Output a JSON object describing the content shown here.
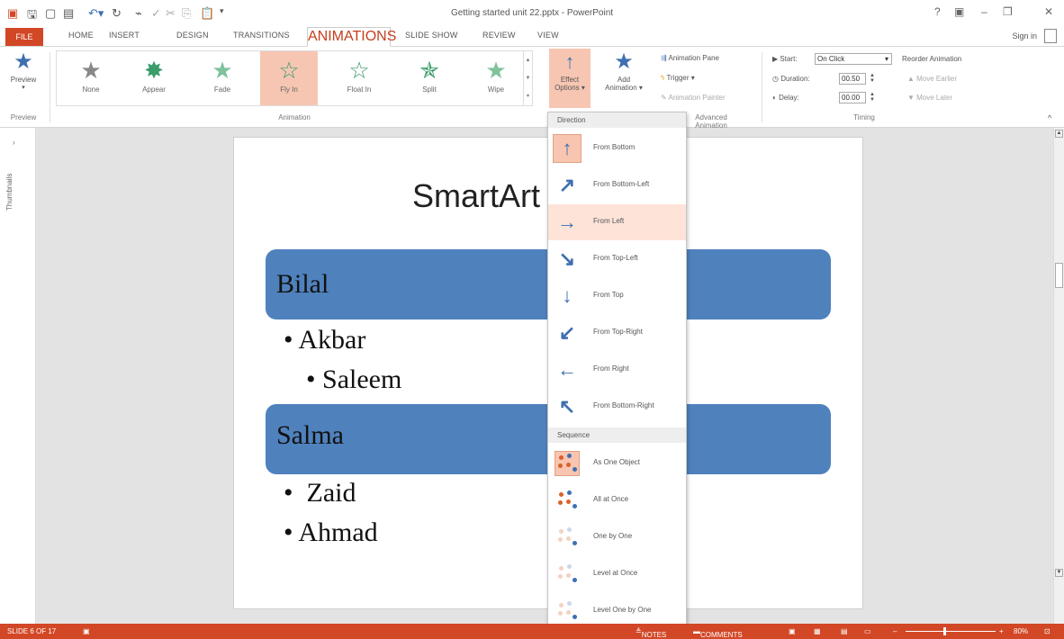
{
  "app": {
    "title": "Getting started unit 22.pptx - PowerPoint",
    "help": "?",
    "sign_in": "Sign in"
  },
  "tabs": [
    "FILE",
    "HOME",
    "INSERT",
    "DESIGN",
    "TRANSITIONS",
    "ANIMATIONS",
    "SLIDE SHOW",
    "REVIEW",
    "VIEW"
  ],
  "ribbon": {
    "preview_label": "Preview",
    "preview_group": "Preview",
    "animation_group": "Animation",
    "advanced_group": "Advanced Animation",
    "timing_group": "Timing",
    "gallery": [
      {
        "label": "None",
        "color": "#888888"
      },
      {
        "label": "Appear",
        "color": "#3a9c6a"
      },
      {
        "label": "Fade",
        "color": "#7fc29b"
      },
      {
        "label": "Fly In",
        "color": "#3a9c6a"
      },
      {
        "label": "Float In",
        "color": "#3a9c6a"
      },
      {
        "label": "Split",
        "color": "#3a9c6a"
      },
      {
        "label": "Wipe",
        "color": "#7fc29b"
      }
    ],
    "effect_options": "Effect",
    "effect_options2": "Options",
    "add_animation": "Add",
    "add_animation2": "Animation",
    "animation_pane": "Animation Pane",
    "trigger": "Trigger",
    "animation_painter": "Animation Painter",
    "start_label": "Start:",
    "start_value": "On Click",
    "duration_label": "Duration:",
    "duration_value": "00.50",
    "delay_label": "Delay:",
    "delay_value": "00.00",
    "reorder": "Reorder Animation",
    "move_earlier": "Move Earlier",
    "move_later": "Move Later"
  },
  "thumbnails_label": "Thumbnails",
  "slide": {
    "title": "SmartArt",
    "box1": "Bilal",
    "bullets1": [
      "Akbar",
      "Saleem"
    ],
    "box2": "Salma",
    "bullets2": [
      "Zaid",
      "Ahmad"
    ]
  },
  "dropdown": {
    "direction_header": "Direction",
    "directions": [
      {
        "label": "From Bottom",
        "arrow": "↑"
      },
      {
        "label": "From Bottom-Left",
        "arrow": "↗"
      },
      {
        "label": "From Left",
        "arrow": "→"
      },
      {
        "label": "From Top-Left",
        "arrow": "↘"
      },
      {
        "label": "From Top",
        "arrow": "↓"
      },
      {
        "label": "From Top-Right",
        "arrow": "↙"
      },
      {
        "label": "From Right",
        "arrow": "←"
      },
      {
        "label": "From Bottom-Right",
        "arrow": "↖"
      }
    ],
    "sequence_header": "Sequence",
    "sequences": [
      "As One Object",
      "All at Once",
      "One by One",
      "Level at Once",
      "Level One by One"
    ]
  },
  "status": {
    "slide": "SLIDE 6 OF 17",
    "notes": "NOTES",
    "comments": "COMMENTS",
    "zoom": "80%"
  }
}
